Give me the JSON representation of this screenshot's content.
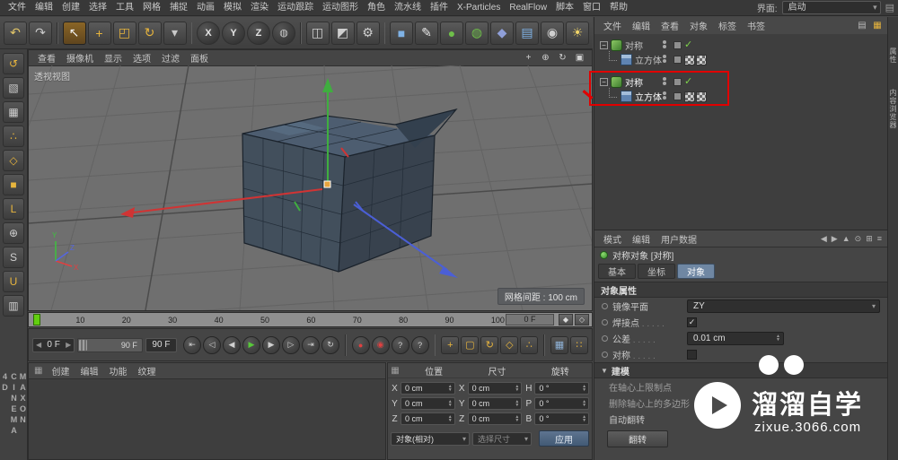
{
  "window": {
    "interface_label": "界面:",
    "interface_value": "启动"
  },
  "menubar": {
    "items": [
      "文件",
      "编辑",
      "创建",
      "选择",
      "工具",
      "网格",
      "捕捉",
      "动画",
      "模拟",
      "渲染",
      "运动跟踪",
      "运动图形",
      "角色",
      "流水线",
      "插件",
      "X-Particles",
      "RealFlow",
      "脚本",
      "窗口",
      "帮助"
    ]
  },
  "toolbar": {
    "history": [
      {
        "name": "undo-button",
        "glyph": "↶",
        "color": "#e0c468"
      },
      {
        "name": "redo-button",
        "glyph": "↷",
        "color": "#c9c9c9"
      }
    ],
    "tools": [
      {
        "name": "live-selection-tool",
        "glyph": "↖",
        "color": "#f2f2f2",
        "cls": "active"
      },
      {
        "name": "move-tool",
        "glyph": "+",
        "color": "#e8b53d"
      },
      {
        "name": "scale-tool",
        "glyph": "◰",
        "color": "#e8b53d"
      },
      {
        "name": "rotate-tool",
        "glyph": "↻",
        "color": "#e8b53d"
      },
      {
        "name": "last-tool-button",
        "glyph": "▾",
        "color": "#c9c9c9"
      }
    ],
    "axis_locks": [
      {
        "name": "lock-x-button",
        "glyph": "X",
        "color": "#e3e3e3",
        "cls": "round"
      },
      {
        "name": "lock-y-button",
        "glyph": "Y",
        "color": "#e3e3e3",
        "cls": "round"
      },
      {
        "name": "lock-z-button",
        "glyph": "Z",
        "color": "#e3e3e3",
        "cls": "round"
      },
      {
        "name": "coordinate-system-button",
        "glyph": "◍",
        "color": "#c9c9c9",
        "cls": "round"
      }
    ],
    "render": [
      {
        "name": "render-view-button",
        "glyph": "◫",
        "color": "#cfcfcf"
      },
      {
        "name": "render-picture-viewer-button",
        "glyph": "◩",
        "color": "#cfcfcf"
      },
      {
        "name": "render-settings-button",
        "glyph": "⚙",
        "color": "#cfcfcf"
      }
    ],
    "objects": [
      {
        "name": "primitive-cube-button",
        "glyph": "■",
        "color": "#7fb2e5"
      },
      {
        "name": "pen-spline-button",
        "glyph": "✎",
        "color": "#e6e6e6"
      },
      {
        "name": "subdivision-surface-button",
        "glyph": "●",
        "color": "#6fbf4a"
      },
      {
        "name": "array-generator-button",
        "glyph": "◍",
        "color": "#6fbf4a"
      },
      {
        "name": "deformer-button",
        "glyph": "◆",
        "color": "#8f9fd8"
      },
      {
        "name": "environment-floor-button",
        "glyph": "▤",
        "color": "#7fb2e5"
      },
      {
        "name": "camera-button",
        "glyph": "◉",
        "color": "#cfcfcf"
      },
      {
        "name": "light-button",
        "glyph": "☀",
        "color": "#f0d468"
      }
    ]
  },
  "left_toolbar": {
    "buttons": [
      {
        "name": "make-editable-button",
        "glyph": "↺",
        "color": "#e8b53d"
      },
      {
        "name": "model-mode-button",
        "glyph": "▧",
        "color": "#cfcfcf"
      },
      {
        "name": "texture-mode-button",
        "glyph": "▦",
        "color": "#cfcfcf"
      },
      {
        "name": "points-mode-button",
        "glyph": "∴",
        "color": "#e8b53d"
      },
      {
        "name": "edges-mode-button",
        "glyph": "◇",
        "color": "#e8b53d"
      },
      {
        "name": "polygons-mode-button",
        "glyph": "■",
        "color": "#e8b53d"
      },
      {
        "name": "axis-mode-button",
        "glyph": "L",
        "color": "#e8b53d"
      },
      {
        "name": "viewport-solo-button",
        "glyph": "⊕",
        "color": "#cfcfcf"
      },
      {
        "name": "snap-button",
        "glyph": "S",
        "color": "#cfcfcf"
      },
      {
        "name": "magnet-snap-button",
        "glyph": "U",
        "color": "#e8b53d"
      },
      {
        "name": "workplane-button",
        "glyph": "▥",
        "color": "#cfcfcf"
      }
    ]
  },
  "logo": {
    "text": "MAXON CINEMA 4D"
  },
  "viewport": {
    "menu": [
      "查看",
      "摄像机",
      "显示",
      "选项",
      "过滤",
      "面板"
    ],
    "controls": [
      {
        "name": "pan-view-icon",
        "glyph": "+"
      },
      {
        "name": "zoom-view-icon",
        "glyph": "⊕"
      },
      {
        "name": "rotate-view-icon",
        "glyph": "↻"
      },
      {
        "name": "maximize-view-icon",
        "glyph": "▣"
      }
    ],
    "view_label": "透视视图",
    "grid_info": "网格间距 : 100 cm",
    "axis_labels": [
      "X",
      "Y",
      "Z"
    ]
  },
  "object_manager": {
    "menu": [
      "文件",
      "编辑",
      "查看",
      "对象",
      "标签",
      "书签"
    ],
    "icons": [
      {
        "name": "layer-manager-icon",
        "glyph": "▤",
        "color": "#b9b9b9"
      },
      {
        "name": "filter-icon",
        "glyph": "▦",
        "color": "#e8b53d"
      }
    ],
    "items": [
      {
        "label": "对称"
      },
      {
        "label": "立方体"
      },
      {
        "label": "对称"
      },
      {
        "label": "立方体"
      }
    ]
  },
  "attributes": {
    "menu": [
      "模式",
      "编辑",
      "用户数据"
    ],
    "icons": [
      {
        "name": "back-icon",
        "glyph": "◀"
      },
      {
        "name": "forward-icon",
        "glyph": "▶"
      },
      {
        "name": "up-icon",
        "glyph": "▲"
      },
      {
        "name": "search-icon",
        "glyph": "⊙"
      },
      {
        "name": "grid-icon",
        "glyph": "⊞"
      },
      {
        "name": "menu-icon",
        "glyph": "≡"
      }
    ],
    "title": "对称对象 [对称]",
    "tabs": [
      "基本",
      "坐标",
      "对象"
    ],
    "section_object": "对象属性",
    "mirror_plane_label": "镜像平面",
    "mirror_plane_value": "ZY",
    "weld_label": "焊接点",
    "tolerance_label": "公差",
    "tolerance_value": "0.01 cm",
    "symmetry_label": "对称",
    "weld_checked": "✓",
    "section_modeling": "建模",
    "modeling_rows": [
      "在轴心上限制点",
      "删除轴心上的多边形",
      "自动翻转"
    ],
    "flip_button": "翻转"
  },
  "timeline": {
    "ticks": [
      "0",
      "10",
      "20",
      "30",
      "40",
      "50",
      "60",
      "70",
      "80",
      "90",
      "100"
    ],
    "frame_box": "0 F",
    "start_field": "0 F",
    "slider_label": "90 F",
    "end_field": "90 F",
    "ruler_keys": [
      {
        "name": "key-marker-button",
        "glyph": "◆"
      },
      {
        "name": "key-frame-button",
        "glyph": "◇"
      }
    ],
    "transport": [
      {
        "name": "goto-start-button",
        "glyph": "⇤",
        "color": "#d0d0d0"
      },
      {
        "name": "prev-key-button",
        "glyph": "◁",
        "color": "#d0d0d0"
      },
      {
        "name": "prev-frame-button",
        "glyph": "◀",
        "color": "#d0d0d0"
      },
      {
        "name": "play-button",
        "glyph": "▶",
        "color": "#58c93a"
      },
      {
        "name": "next-frame-button",
        "glyph": "▶",
        "color": "#d0d0d0"
      },
      {
        "name": "next-key-button",
        "glyph": "▷",
        "color": "#d0d0d0"
      },
      {
        "name": "goto-end-button",
        "glyph": "⇥",
        "color": "#d0d0d0"
      },
      {
        "name": "loop-button",
        "glyph": "↻",
        "color": "#d0d0d0"
      }
    ],
    "record": [
      {
        "name": "record-keyframe-button",
        "glyph": "●",
        "color": "#e04040"
      },
      {
        "name": "autokey-button",
        "glyph": "◉",
        "color": "#e04040"
      },
      {
        "name": "keyframe-selection-button",
        "glyph": "?",
        "color": "#d0d0d0"
      },
      {
        "name": "keyframe-presets-button",
        "glyph": "?",
        "color": "#d0d0d0"
      }
    ],
    "toggles": [
      {
        "name": "record-position-toggle",
        "glyph": "+",
        "color": "#e8b53d"
      },
      {
        "name": "record-scale-toggle",
        "glyph": "▢",
        "color": "#e8b53d"
      },
      {
        "name": "record-rotation-toggle",
        "glyph": "↻",
        "color": "#e8b53d"
      },
      {
        "name": "record-parameter-toggle",
        "glyph": "◇",
        "color": "#e8b53d"
      },
      {
        "name": "record-pla-toggle",
        "glyph": "∴",
        "color": "#e8b53d"
      }
    ],
    "extra": [
      {
        "name": "solo-grid-button",
        "glyph": "▦",
        "color": "#8fb3d8"
      },
      {
        "name": "dot-grid-button",
        "glyph": "∷",
        "color": "#e8b53d"
      }
    ]
  },
  "materials_panel": {
    "menu": [
      "创建",
      "编辑",
      "功能",
      "纹理"
    ]
  },
  "coordinates": {
    "headers": [
      "位置",
      "尺寸",
      "旋转"
    ],
    "rows": [
      {
        "axis": "X",
        "pos": "0 cm",
        "size_axis": "X",
        "size": "0 cm",
        "rot_axis": "H",
        "rot": "0 °"
      },
      {
        "axis": "Y",
        "pos": "0 cm",
        "size_axis": "Y",
        "size": "0 cm",
        "rot_axis": "P",
        "rot": "0 °"
      },
      {
        "axis": "Z",
        "pos": "0 cm",
        "size_axis": "Z",
        "size": "0 cm",
        "rot_axis": "B",
        "rot": "0 °"
      }
    ],
    "mode_dropdown": "对象(相对)",
    "size_dropdown": "选择尺寸",
    "apply_button": "应用"
  },
  "right_edge": {
    "tabs": [
      "属性",
      "内容浏览器"
    ]
  },
  "watermark": {
    "brand": "溜溜自学",
    "url": "zixue.3066.com"
  }
}
